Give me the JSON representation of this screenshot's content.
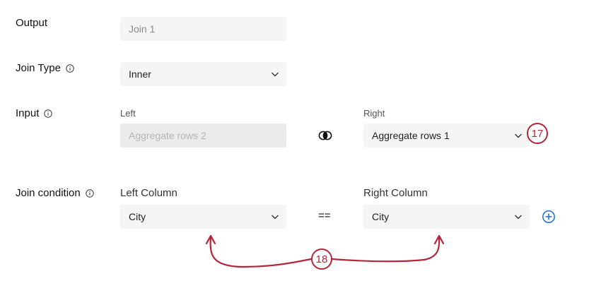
{
  "output": {
    "label": "Output",
    "value": "Join 1"
  },
  "join_type": {
    "label": "Join Type",
    "value": "Inner"
  },
  "input": {
    "label": "Input",
    "left_label": "Left",
    "left_value": "Aggregate rows 2",
    "right_label": "Right",
    "right_value": "Aggregate rows 1"
  },
  "join_condition": {
    "label": "Join condition",
    "left_column_label": "Left Column",
    "left_value": "City",
    "operator": "==",
    "right_column_label": "Right Column",
    "right_value": "City"
  },
  "callouts": {
    "a": "17",
    "b": "18"
  },
  "colors": {
    "callout": "#b5253a",
    "accent_blue": "#1f6fd1",
    "field_bg": "#f5f5f5"
  }
}
